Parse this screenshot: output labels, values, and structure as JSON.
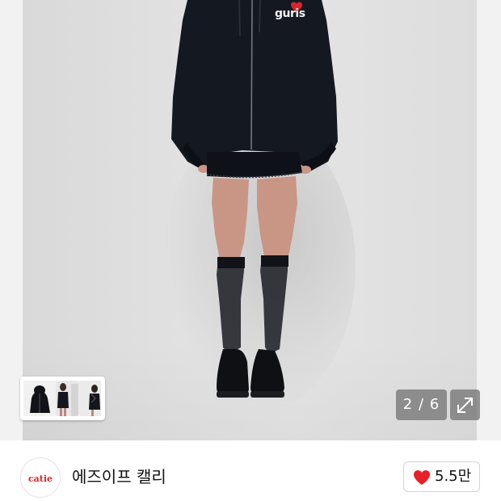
{
  "viewer": {
    "current_page": 2,
    "total_pages": 6,
    "counter_text": "2 / 6"
  },
  "thumbnails": {
    "count": 3
  },
  "seller": {
    "logo_text": "catie",
    "name": "에즈이프 캘리"
  },
  "like": {
    "count_label": "5.5만"
  },
  "photo": {
    "hoodie_print": "guris"
  },
  "colors": {
    "heart": "#e8202a",
    "logo": "#d9262c",
    "overlay": "#6e6e6e"
  },
  "icons": [
    "chevron-right-icon",
    "expand-icon",
    "heart-icon"
  ]
}
